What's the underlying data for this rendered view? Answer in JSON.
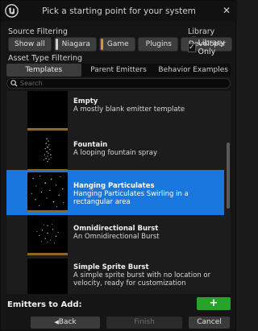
{
  "window": {
    "title": "Pick a starting point for your system",
    "close_glyph": "✕"
  },
  "source_filtering": {
    "label": "Source Filtering",
    "buttons": [
      {
        "label": "Show all",
        "color": ""
      },
      {
        "label": "Niagara",
        "color": "#d0d0d0"
      },
      {
        "label": "Game",
        "color": "#d49a2c"
      },
      {
        "label": "Plugins",
        "color": ""
      },
      {
        "label": "Developer",
        "color": ""
      }
    ]
  },
  "library_filter": {
    "label": "Library Filter",
    "library_only_label": "Library Only",
    "checked_glyph": "✓"
  },
  "asset_type_filtering": {
    "label": "Asset Type Filtering",
    "tabs": [
      "Templates",
      "Parent Emitters",
      "Behavior Examples"
    ],
    "active_tab": 0
  },
  "search": {
    "placeholder": "Search"
  },
  "items": [
    {
      "title": "Empty",
      "description": "A mostly blank emitter template",
      "selected": false
    },
    {
      "title": "Fountain",
      "description": "A looping fountain spray",
      "selected": false
    },
    {
      "title": "Hanging Particulates",
      "description": "Hanging Particulates Swirling in a rectangular area",
      "selected": true
    },
    {
      "title": "Omnidirectional Burst",
      "description": "An Omnidirectional Burst",
      "selected": false
    },
    {
      "title": "Simple Sprite Burst",
      "description": "A simple sprite burst with no location or velocity, ready for customization",
      "selected": false
    }
  ],
  "emitters_to_add": {
    "label": "Emitters to Add:",
    "add_glyph": "+"
  },
  "footer": {
    "back_label": "Back",
    "back_glyph": "◀",
    "finish_label": "Finish",
    "cancel_label": "Cancel"
  },
  "colors": {
    "selection": "#1a77de",
    "add_button": "#2aa12a",
    "game_source": "#d49a2c"
  },
  "icons": {
    "logo": "unreal-engine-logo",
    "search": "search-icon",
    "close": "close-icon"
  }
}
